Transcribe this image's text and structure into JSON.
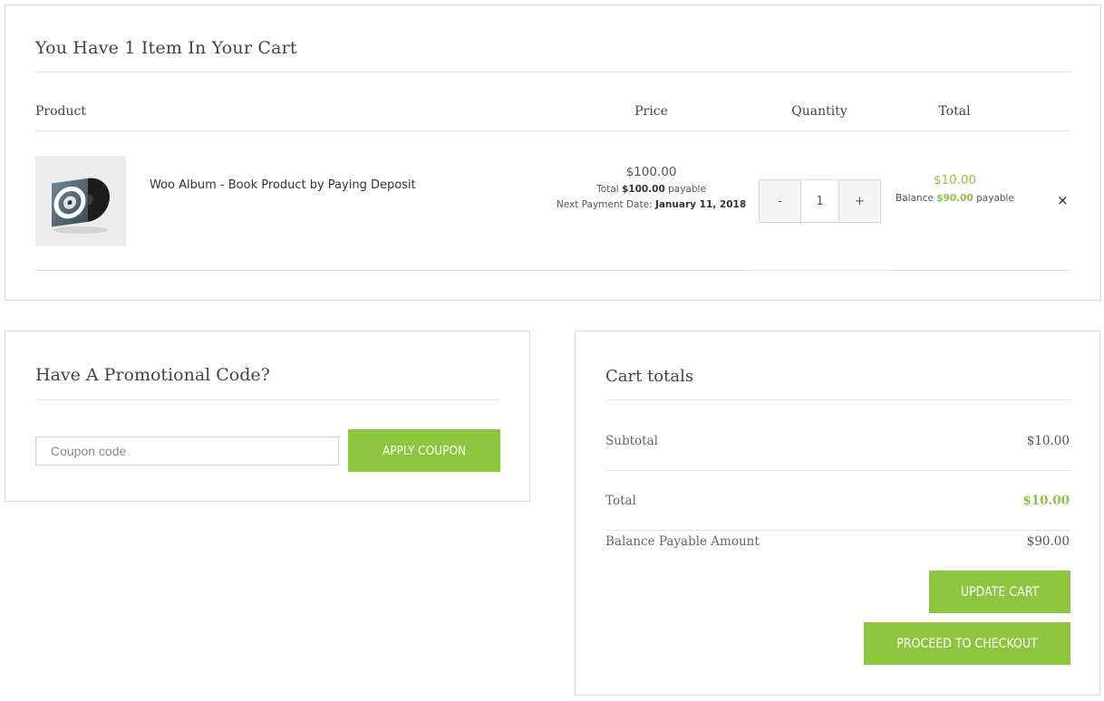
{
  "cart": {
    "title": "You Have 1 Item In Your Cart",
    "columns": {
      "product": "Product",
      "price": "Price",
      "quantity": "Quantity",
      "total": "Total"
    },
    "item": {
      "name": "Woo Album - Book Product by Paying Deposit",
      "price": "$100.00",
      "total_prefix": "Total ",
      "total_amount": "$100.00",
      "total_suffix": " payable",
      "next_payment_prefix": "Next Payment Date: ",
      "next_payment_date": "January 11, 2018",
      "quantity_minus": "-",
      "quantity": "1",
      "quantity_plus": "+",
      "line_total": "$10.00",
      "balance_prefix": "Balance ",
      "balance_amount": "$90.00",
      "balance_suffix": " payable",
      "remove": "×"
    }
  },
  "promo": {
    "title": "Have A Promotional Code?",
    "coupon_placeholder": "Coupon code",
    "apply_label": "APPLY COUPON"
  },
  "totals": {
    "title": "Cart totals",
    "subtotal_label": "Subtotal",
    "subtotal_value": "$10.00",
    "total_label": "Total",
    "total_value": "$10.00",
    "balance_label": "Balance Payable Amount",
    "balance_value": "$90.00",
    "update_label": "UPDATE CART",
    "checkout_label": "PROCEED TO CHECKOUT"
  },
  "colors": {
    "accent": "#8cc63f",
    "border": "#dcdcdc",
    "text": "#333333"
  }
}
